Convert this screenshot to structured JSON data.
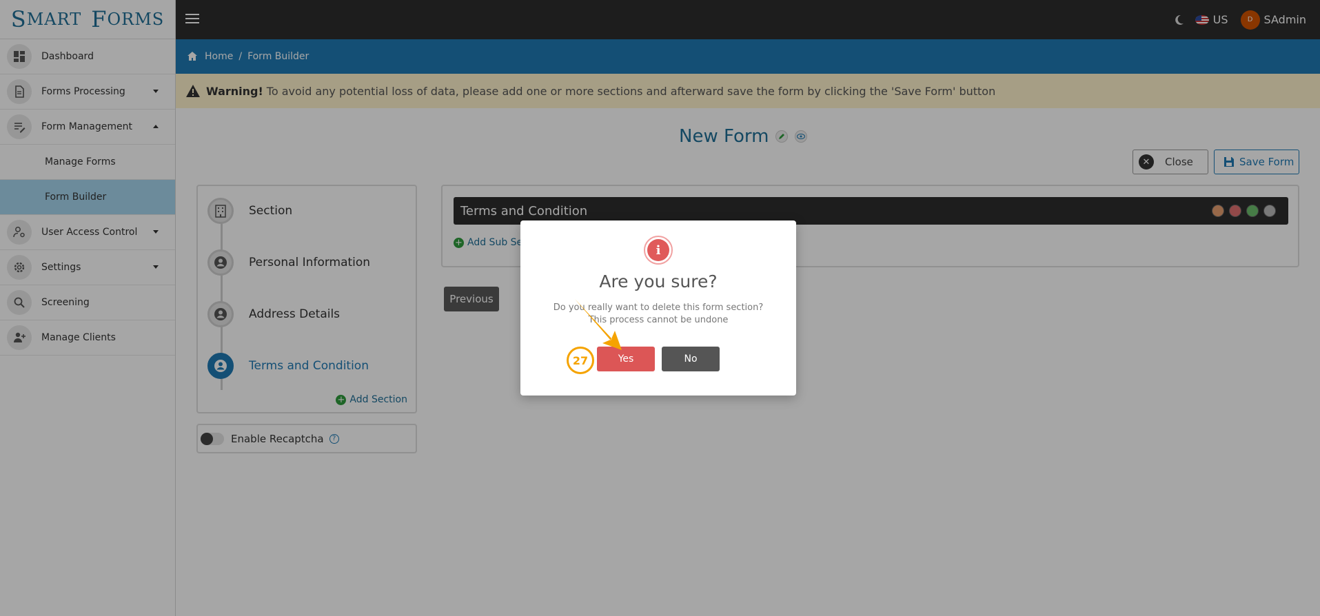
{
  "brand": {
    "first_big": "S",
    "first_rest": "MART",
    "second_big": "F",
    "second_rest": "ORMS"
  },
  "sidebar": {
    "items": [
      {
        "label": "Dashboard",
        "icon": "dashboard-icon"
      },
      {
        "label": "Forms Processing",
        "icon": "document-icon",
        "caret": "down"
      },
      {
        "label": "Form Management",
        "icon": "edit-list-icon",
        "caret": "up"
      },
      {
        "label": "User Access Control",
        "icon": "user-settings-icon",
        "caret": "down"
      },
      {
        "label": "Settings",
        "icon": "gear-icon",
        "caret": "down"
      },
      {
        "label": "Screening",
        "icon": "search-icon"
      },
      {
        "label": "Manage Clients",
        "icon": "user-add-icon"
      }
    ],
    "sub_items": [
      {
        "label": "Manage Forms",
        "active": false
      },
      {
        "label": "Form Builder",
        "active": true
      }
    ]
  },
  "topbar": {
    "locale": "US",
    "avatar_initial": "D",
    "username": "SAdmin"
  },
  "breadcrumb": {
    "home": "Home",
    "sep": "/",
    "current": "Form Builder"
  },
  "warning": {
    "label": "Warning!",
    "text": "To avoid any potential loss of data, please add one or more sections and afterward save the form by clicking the 'Save Form' button"
  },
  "form": {
    "title": "New Form",
    "close_label": "Close",
    "save_label": "Save Form",
    "steps": [
      {
        "label": "Section",
        "icon": "building-icon",
        "active": false
      },
      {
        "label": "Personal Information",
        "icon": "user-circle-icon",
        "active": false
      },
      {
        "label": "Address Details",
        "icon": "user-circle-icon",
        "active": false
      },
      {
        "label": "Terms and Condition",
        "icon": "user-circle-icon",
        "active": true
      }
    ],
    "add_section_label": "Add Section",
    "recaptcha_label": "Enable Recaptcha",
    "recaptcha_help": "?",
    "section_header": "Terms and Condition",
    "add_sub_label": "Add Sub Se",
    "previous_label": "Previous"
  },
  "dialog": {
    "icon_glyph": "i",
    "title": "Are you sure?",
    "line1": "Do you really want to delete this form section?",
    "line2": "This process cannot be undone",
    "yes_label": "Yes",
    "no_label": "No"
  },
  "annotation": {
    "step_number": "27"
  },
  "colors": {
    "accent": "#1f7ab4",
    "topbar": "#2d2d2d",
    "danger": "#dc5656",
    "highlight": "#f5a300"
  }
}
